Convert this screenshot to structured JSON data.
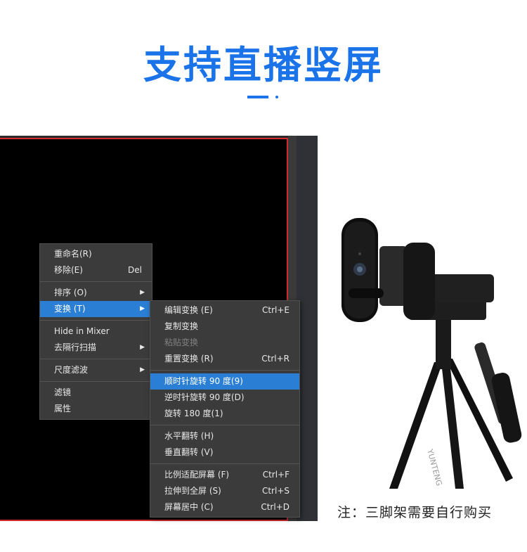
{
  "header": {
    "title": "支持直播竖屏"
  },
  "context_menu": {
    "items": [
      {
        "label": "重命名(R)",
        "shortcut": ""
      },
      {
        "label": "移除(E)",
        "shortcut": "Del"
      },
      {
        "label": "排序 (O)",
        "shortcut": ""
      },
      {
        "label": "变换 (T)",
        "shortcut": ""
      },
      {
        "label": "Hide in Mixer",
        "shortcut": ""
      },
      {
        "label": "去隔行扫描",
        "shortcut": ""
      },
      {
        "label": "尺度滤波",
        "shortcut": ""
      },
      {
        "label": "滤镜",
        "shortcut": ""
      },
      {
        "label": "属性",
        "shortcut": ""
      }
    ]
  },
  "submenu": {
    "items": [
      {
        "label": "编辑变换 (E)",
        "shortcut": "Ctrl+E"
      },
      {
        "label": "复制变换",
        "shortcut": ""
      },
      {
        "label": "粘贴变换",
        "shortcut": ""
      },
      {
        "label": "重置变换 (R)",
        "shortcut": "Ctrl+R"
      },
      {
        "label": "顺时针旋转 90 度(9)",
        "shortcut": ""
      },
      {
        "label": "逆时针旋转 90 度(D)",
        "shortcut": ""
      },
      {
        "label": "旋转 180 度(1)",
        "shortcut": ""
      },
      {
        "label": "水平翻转 (H)",
        "shortcut": ""
      },
      {
        "label": "垂直翻转 (V)",
        "shortcut": ""
      },
      {
        "label": "比例适配屏幕 (F)",
        "shortcut": "Ctrl+F"
      },
      {
        "label": "拉伸到全屏 (S)",
        "shortcut": "Ctrl+S"
      },
      {
        "label": "屏幕居中 (C)",
        "shortcut": "Ctrl+D"
      }
    ]
  },
  "photo": {
    "tripod_brand": "YUNTENG"
  },
  "caption": "注：三脚架需要自行购买",
  "colors": {
    "accent": "#1a73e8",
    "menu_highlight": "#2a7fd4",
    "canvas_border": "#d12a2a"
  }
}
